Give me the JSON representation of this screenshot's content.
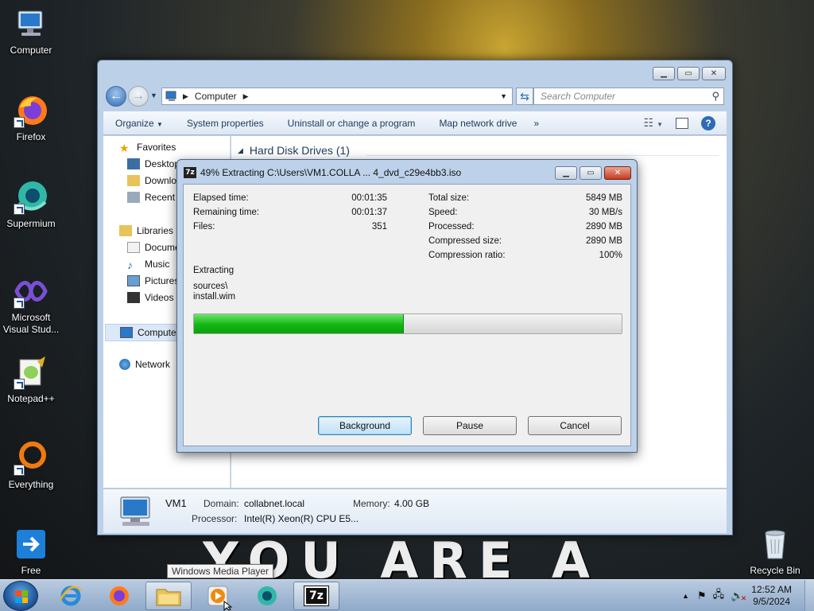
{
  "desktop": {
    "icons": [
      {
        "label": "Computer",
        "icon": "computer-icon"
      },
      {
        "label": "Firefox",
        "icon": "firefox-icon"
      },
      {
        "label": "Supermium",
        "icon": "supermium-icon"
      },
      {
        "label": "Microsoft Visual Stud...",
        "icon": "visual-studio-icon"
      },
      {
        "label": "Notepad++",
        "icon": "notepadpp-icon"
      },
      {
        "label": "Everything",
        "icon": "everything-icon"
      },
      {
        "label": "Free",
        "icon": "free-icon"
      },
      {
        "label": "Recycle Bin",
        "icon": "recycle-bin-icon"
      }
    ],
    "wallpaper_text": "YOU ARE A NERD"
  },
  "explorer": {
    "address": "Computer",
    "search_placeholder": "Search Computer",
    "toolbar": {
      "organize": "Organize",
      "system_properties": "System properties",
      "uninstall": "Uninstall or change a program",
      "map_drive": "Map network drive",
      "more": "»"
    },
    "nav": {
      "favorites": "Favorites",
      "desktop": "Desktop",
      "downloads": "Downloads",
      "recent": "Recent Places",
      "libraries": "Libraries",
      "documents": "Documents",
      "music": "Music",
      "pictures": "Pictures",
      "videos": "Videos",
      "computer": "Computer",
      "network": "Network"
    },
    "section_header": "Hard Disk Drives (1)",
    "details": {
      "name": "VM1",
      "domain_label": "Domain:",
      "domain_value": "collabnet.local",
      "memory_label": "Memory:",
      "memory_value": "4.00 GB",
      "processor_label": "Processor:",
      "processor_value": "Intel(R) Xeon(R) CPU E5..."
    }
  },
  "zip": {
    "title": "49% Extracting C:\\Users\\VM1.COLLA ... 4_dvd_c29e4bb3.iso",
    "left": {
      "elapsed_label": "Elapsed time:",
      "elapsed_value": "00:01:35",
      "remaining_label": "Remaining time:",
      "remaining_value": "00:01:37",
      "files_label": "Files:",
      "files_value": "351"
    },
    "right": {
      "total_label": "Total size:",
      "total_value": "5849 MB",
      "speed_label": "Speed:",
      "speed_value": "30 MB/s",
      "processed_label": "Processed:",
      "processed_value": "2890 MB",
      "compressed_label": "Compressed size:",
      "compressed_value": "2890 MB",
      "ratio_label": "Compression ratio:",
      "ratio_value": "100%"
    },
    "action": "Extracting",
    "path_line1": "sources\\",
    "path_line2": "install.wim",
    "progress": 0.49,
    "buttons": {
      "background": "Background",
      "pause": "Pause",
      "cancel": "Cancel"
    }
  },
  "tooltip": "Windows Media Player",
  "taskbar": {
    "zip_label": "7z",
    "clock_time": "12:52 AM",
    "clock_date": "9/5/2024"
  }
}
